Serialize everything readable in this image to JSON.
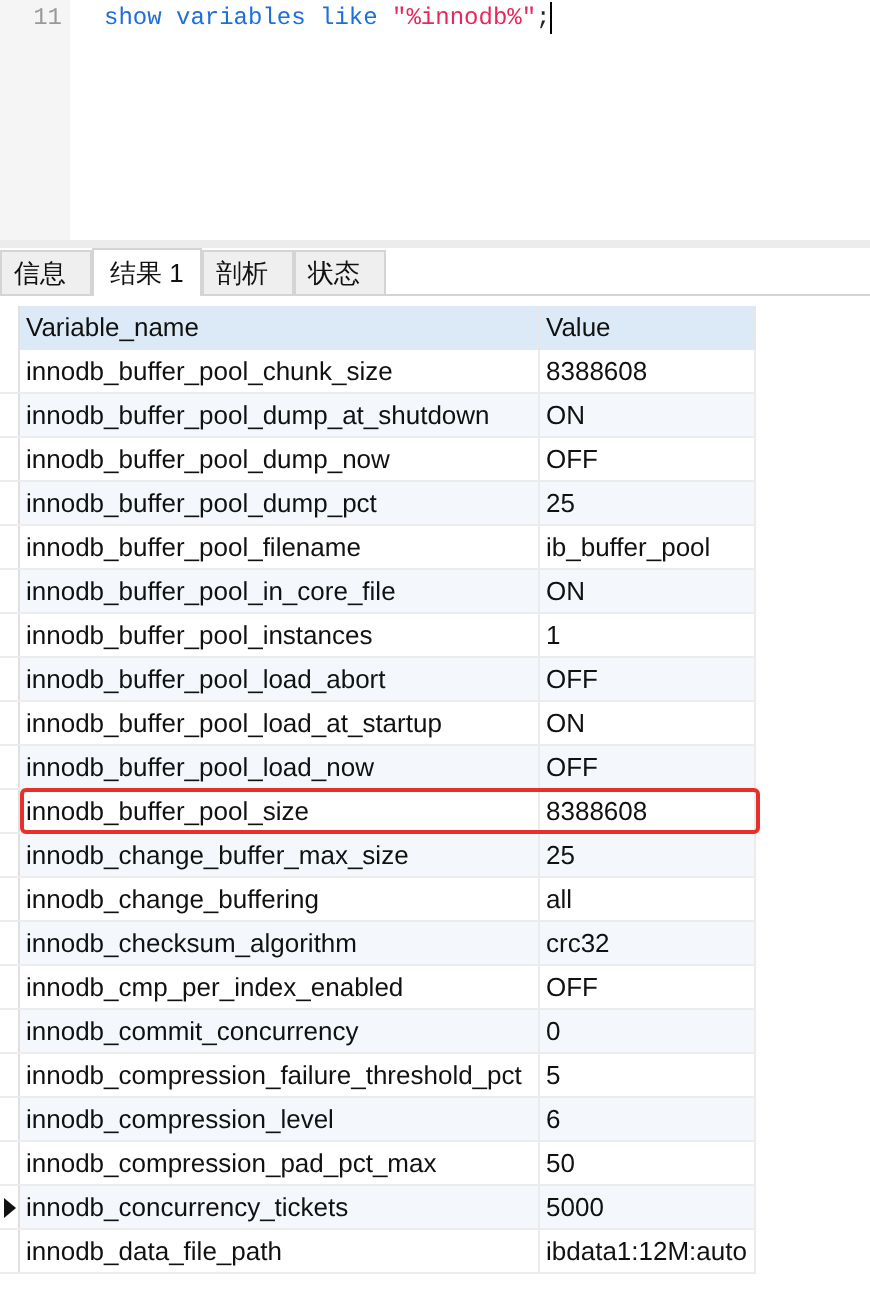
{
  "editor": {
    "lines": [
      {
        "number": "11",
        "tokens": [
          {
            "kind": "keyword",
            "text": "show variables like "
          },
          {
            "kind": "string",
            "text": "\"%innodb%\""
          },
          {
            "kind": "plain",
            "text": ";"
          }
        ]
      }
    ]
  },
  "tabs": [
    {
      "label": "信息",
      "selected": false
    },
    {
      "label": "结果 1",
      "selected": true
    },
    {
      "label": "剖析",
      "selected": false
    },
    {
      "label": "状态",
      "selected": false
    }
  ],
  "table": {
    "columns": [
      "Variable_name",
      "Value"
    ],
    "rows": [
      {
        "cells": [
          "innodb_buffer_pool_chunk_size",
          "8388608"
        ],
        "highlighted": false,
        "current": false
      },
      {
        "cells": [
          "innodb_buffer_pool_dump_at_shutdown",
          "ON"
        ],
        "highlighted": false,
        "current": false
      },
      {
        "cells": [
          "innodb_buffer_pool_dump_now",
          "OFF"
        ],
        "highlighted": false,
        "current": false
      },
      {
        "cells": [
          "innodb_buffer_pool_dump_pct",
          "25"
        ],
        "highlighted": false,
        "current": false
      },
      {
        "cells": [
          "innodb_buffer_pool_filename",
          "ib_buffer_pool"
        ],
        "highlighted": false,
        "current": false
      },
      {
        "cells": [
          "innodb_buffer_pool_in_core_file",
          "ON"
        ],
        "highlighted": false,
        "current": false
      },
      {
        "cells": [
          "innodb_buffer_pool_instances",
          "1"
        ],
        "highlighted": false,
        "current": false
      },
      {
        "cells": [
          "innodb_buffer_pool_load_abort",
          "OFF"
        ],
        "highlighted": false,
        "current": false
      },
      {
        "cells": [
          "innodb_buffer_pool_load_at_startup",
          "ON"
        ],
        "highlighted": false,
        "current": false
      },
      {
        "cells": [
          "innodb_buffer_pool_load_now",
          "OFF"
        ],
        "highlighted": false,
        "current": false
      },
      {
        "cells": [
          "innodb_buffer_pool_size",
          "8388608"
        ],
        "highlighted": true,
        "current": false
      },
      {
        "cells": [
          "innodb_change_buffer_max_size",
          "25"
        ],
        "highlighted": false,
        "current": false
      },
      {
        "cells": [
          "innodb_change_buffering",
          "all"
        ],
        "highlighted": false,
        "current": false
      },
      {
        "cells": [
          "innodb_checksum_algorithm",
          "crc32"
        ],
        "highlighted": false,
        "current": false
      },
      {
        "cells": [
          "innodb_cmp_per_index_enabled",
          "OFF"
        ],
        "highlighted": false,
        "current": false
      },
      {
        "cells": [
          "innodb_commit_concurrency",
          "0"
        ],
        "highlighted": false,
        "current": false
      },
      {
        "cells": [
          "innodb_compression_failure_threshold_pct",
          "5"
        ],
        "highlighted": false,
        "current": false
      },
      {
        "cells": [
          "innodb_compression_level",
          "6"
        ],
        "highlighted": false,
        "current": false
      },
      {
        "cells": [
          "innodb_compression_pad_pct_max",
          "50"
        ],
        "highlighted": false,
        "current": false
      },
      {
        "cells": [
          "innodb_concurrency_tickets",
          "5000"
        ],
        "highlighted": false,
        "current": true
      },
      {
        "cells": [
          "innodb_data_file_path",
          "ibdata1:12M:auto"
        ],
        "highlighted": false,
        "current": false
      }
    ]
  }
}
